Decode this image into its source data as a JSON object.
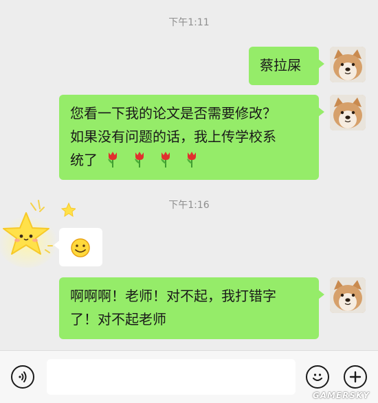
{
  "messages": {
    "time1": "下午1:11",
    "msg1": "蔡拉屎",
    "msg2_line1": "您看一下我的论文是否需要修改？",
    "msg2_line2": "如果没有问题的话，我上传学校系",
    "msg2_line3": "统了",
    "time2": "下午1:16",
    "msg4_line1": "啊啊啊！老师！对不起，我打错字",
    "msg4_line2": "了！对不起老师"
  },
  "input_bar": {
    "voice_icon": "voice-icon",
    "emoji_icon": "emoji-icon",
    "add_icon": "plus-icon"
  },
  "watermark": "GAMERSKY",
  "colors": {
    "background": "#ededed",
    "sent_bubble": "#95ec69",
    "received_bubble": "#ffffff"
  }
}
